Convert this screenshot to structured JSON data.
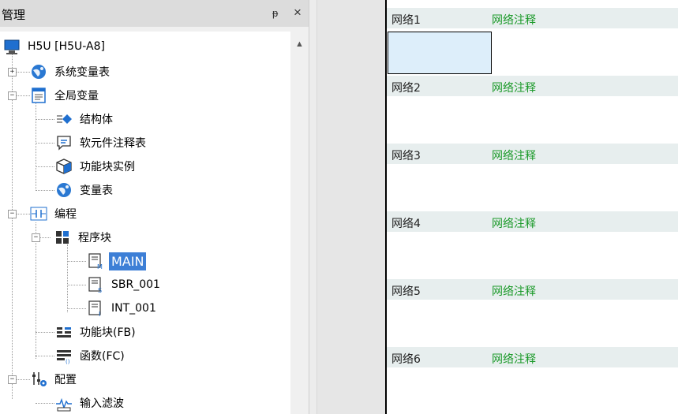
{
  "panel": {
    "title": "管理",
    "pin_glyph": "ᵽ",
    "close_glyph": "×"
  },
  "tree": {
    "root": "H5U [H5U-A8]",
    "system_vars": "系统变量表",
    "global_vars": "全局变量",
    "struct": "结构体",
    "device_comment": "软元件注释表",
    "fb_instance": "功能块实例",
    "var_table": "变量表",
    "programming": "编程",
    "program_block": "程序块",
    "main": "MAIN",
    "sbr": "SBR_001",
    "int": "INT_001",
    "fb": "功能块(FB)",
    "fc": "函数(FC)",
    "config": "配置",
    "input_filter": "输入滤波"
  },
  "networks": [
    {
      "name": "网络1",
      "comment": "网络注释"
    },
    {
      "name": "网络2",
      "comment": "网络注释"
    },
    {
      "name": "网络3",
      "comment": "网络注释"
    },
    {
      "name": "网络4",
      "comment": "网络注释"
    },
    {
      "name": "网络5",
      "comment": "网络注释"
    },
    {
      "name": "网络6",
      "comment": "网络注释"
    }
  ],
  "colors": {
    "accent": "#3d7fd6",
    "comment": "#1c9a2a",
    "network_header": "#e7eeee"
  }
}
